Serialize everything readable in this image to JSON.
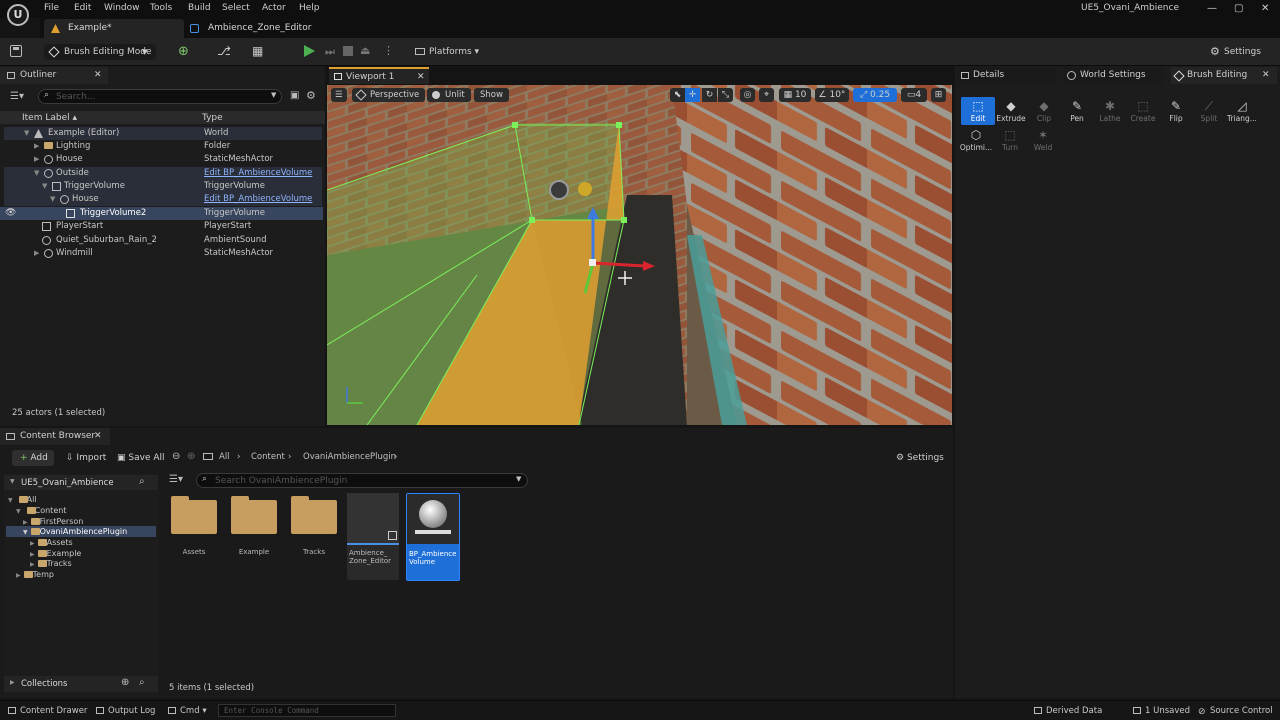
{
  "titlebar": {
    "logo": "U",
    "menu": [
      "File",
      "Edit",
      "Window",
      "Tools",
      "Build",
      "Select",
      "Actor",
      "Help"
    ],
    "project": "UE5_Ovani_Ambience",
    "controls": {
      "minimize": "—",
      "maximize": "▢",
      "close": "✕"
    }
  },
  "tabs": [
    {
      "label": "Example*",
      "icon": "level-icon"
    },
    {
      "label": "Ambience_Zone_Editor",
      "icon": "blueprint-icon"
    }
  ],
  "toolbar": {
    "mode": "Brush Editing Mode",
    "platforms": "Platforms",
    "settings": "Settings"
  },
  "outliner": {
    "title": "Outliner",
    "search_placeholder": "Search...",
    "col_label": "Item Label ▴",
    "col_type": "Type",
    "rows": [
      {
        "label": "Example (Editor)",
        "type": "World",
        "link": false
      },
      {
        "label": "Lighting",
        "type": "Folder",
        "link": false
      },
      {
        "label": "House",
        "type": "StaticMeshActor",
        "link": false
      },
      {
        "label": "Outside",
        "type": "Edit BP_AmbienceVolume",
        "link": true
      },
      {
        "label": "TriggerVolume",
        "type": "TriggerVolume",
        "link": false
      },
      {
        "label": "House",
        "type": "Edit BP_AmbienceVolume",
        "link": true
      },
      {
        "label": "TriggerVolume2",
        "type": "TriggerVolume",
        "link": false
      },
      {
        "label": "PlayerStart",
        "type": "PlayerStart",
        "link": false
      },
      {
        "label": "Quiet_Suburban_Rain_2",
        "type": "AmbientSound",
        "link": false
      },
      {
        "label": "Windmill",
        "type": "StaticMeshActor",
        "link": false
      }
    ],
    "footer": "25 actors (1 selected)"
  },
  "viewport": {
    "tab": "Viewport 1",
    "perspective": "Perspective",
    "unlit": "Unlit",
    "show": "Show",
    "grid_snap": "10",
    "rot_snap": "10°",
    "scale_snap": "0.25",
    "camera_speed": "4"
  },
  "details": {
    "tabs": [
      "Details",
      "World Settings",
      "Brush Editing"
    ],
    "tools": [
      {
        "label": "Edit",
        "icon": "cursor-icon",
        "glyph": "⬚",
        "enabled": true,
        "active": true
      },
      {
        "label": "Extrude",
        "icon": "eraser-icon",
        "glyph": "◆",
        "enabled": true,
        "active": false
      },
      {
        "label": "Clip",
        "icon": "eraser-icon",
        "glyph": "◆",
        "enabled": false,
        "active": false
      },
      {
        "label": "Pen",
        "icon": "pen-icon",
        "glyph": "✎",
        "enabled": true,
        "active": false
      },
      {
        "label": "Lathe",
        "icon": "lathe-icon",
        "glyph": "✱",
        "enabled": false,
        "active": false
      },
      {
        "label": "Create",
        "icon": "create-icon",
        "glyph": "⬚",
        "enabled": false,
        "active": false
      },
      {
        "label": "Flip",
        "icon": "flip-icon",
        "glyph": "✎",
        "enabled": true,
        "active": false
      },
      {
        "label": "Split",
        "icon": "split-icon",
        "glyph": "⟋",
        "enabled": false,
        "active": false
      },
      {
        "label": "Triang...",
        "icon": "triangulate-icon",
        "glyph": "◿",
        "enabled": true,
        "active": false
      },
      {
        "label": "Optimi...",
        "icon": "optimize-icon",
        "glyph": "⬡",
        "enabled": true,
        "active": false
      },
      {
        "label": "Turn",
        "icon": "turn-icon",
        "glyph": "⬚",
        "enabled": false,
        "active": false
      },
      {
        "label": "Weld",
        "icon": "weld-icon",
        "glyph": "✶",
        "enabled": false,
        "active": false
      }
    ]
  },
  "content_browser": {
    "title": "Content Browser",
    "add": "Add",
    "import": "Import",
    "save_all": "Save All",
    "path": [
      "All",
      "Content",
      "OvaniAmbiencePlugin"
    ],
    "settings": "Settings",
    "project": "UE5_Ovani_Ambience",
    "search_placeholder": "Search OvaniAmbiencePlugin",
    "tree": [
      {
        "label": "All",
        "depth": 0
      },
      {
        "label": "Content",
        "depth": 1
      },
      {
        "label": "FirstPerson",
        "depth": 2
      },
      {
        "label": "OvaniAmbiencePlugin",
        "depth": 2
      },
      {
        "label": "Assets",
        "depth": 3
      },
      {
        "label": "Example",
        "depth": 3
      },
      {
        "label": "Tracks",
        "depth": 3
      },
      {
        "label": "Temp",
        "depth": 1
      }
    ],
    "assets": [
      {
        "label": "Assets",
        "kind": "folder"
      },
      {
        "label": "Example",
        "kind": "folder"
      },
      {
        "label": "Tracks",
        "kind": "folder"
      },
      {
        "label": "Ambience_ Zone_Editor",
        "kind": "widget"
      },
      {
        "label": "BP_Ambience Volume",
        "kind": "blueprint"
      }
    ],
    "collections": "Collections",
    "footer": "5 items (1 selected)"
  },
  "statusbar": {
    "content_drawer": "Content Drawer",
    "output_log": "Output Log",
    "cmd": "Cmd",
    "console_placeholder": "Enter Console Command",
    "derived_data": "Derived Data",
    "unsaved": "1 Unsaved",
    "source_control": "Source Control"
  },
  "colors": {
    "accent": "#1f6fd8",
    "link": "#8fb4ff",
    "play": "#4caf50",
    "selection_row": "#38455e",
    "brush_wire": "#7cf05a",
    "volume_fill": "#e0a030"
  }
}
